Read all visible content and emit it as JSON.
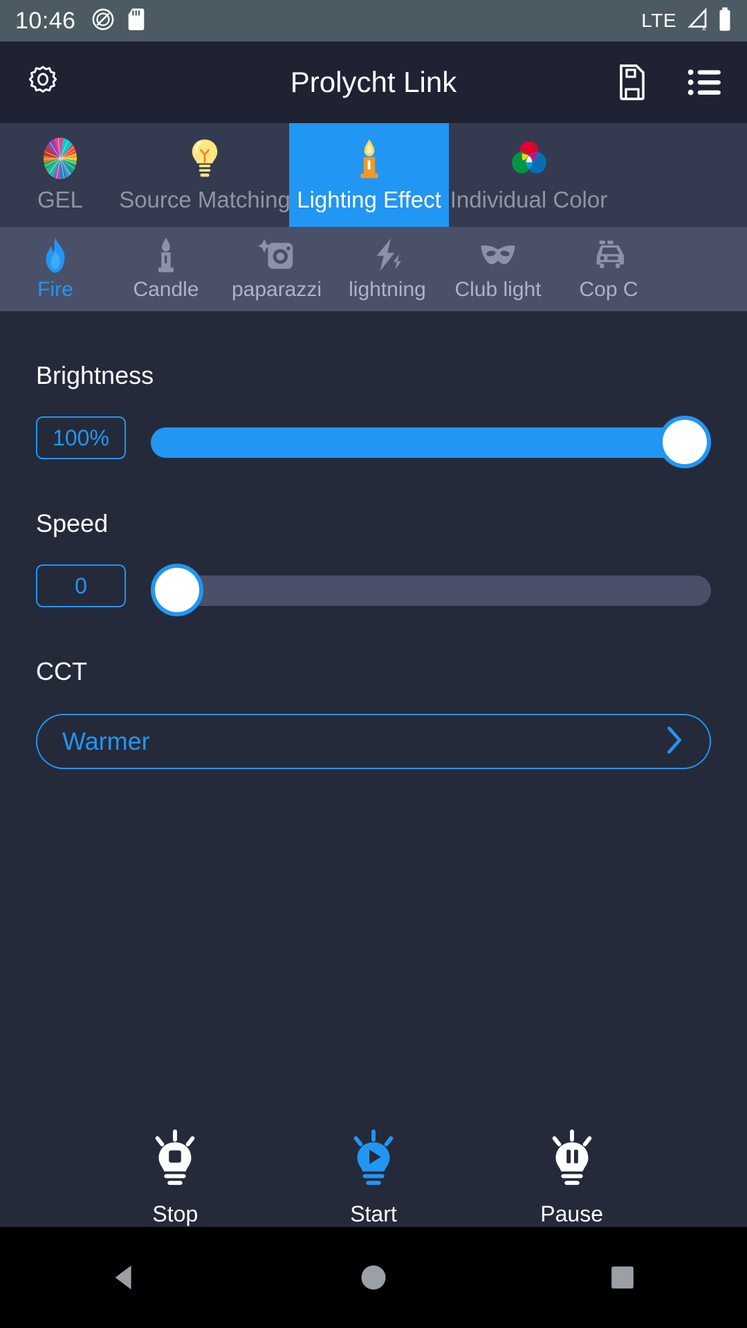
{
  "status_bar": {
    "time": "10:46",
    "icons": [
      "do-not-disturb-icon",
      "sd-card-icon"
    ],
    "network_label": "LTE",
    "right_icons": [
      "signal-no-service-icon",
      "battery-icon"
    ]
  },
  "app_bar": {
    "title": "Prolycht Link",
    "left_icon": "gear-icon",
    "right_icons": [
      "save-file-icon",
      "list-menu-icon"
    ]
  },
  "main_tabs": {
    "selected_index": 2,
    "items": [
      {
        "label": "GEL",
        "icon": "color-wheel-icon"
      },
      {
        "label": "Source Matching",
        "icon": "lightbulb-icon"
      },
      {
        "label": "Lighting Effect",
        "icon": "candle-icon"
      },
      {
        "label": "Individual Color",
        "icon": "rgb-circles-icon"
      }
    ]
  },
  "effect_tabs": {
    "selected_index": 0,
    "items": [
      {
        "label": "Fire",
        "icon": "flame-icon"
      },
      {
        "label": "Candle",
        "icon": "candle-icon"
      },
      {
        "label": "paparazzi",
        "icon": "camera-icon"
      },
      {
        "label": "lightning",
        "icon": "lightning-bolt-icon"
      },
      {
        "label": "Club light",
        "icon": "mask-icon"
      },
      {
        "label": "Cop C",
        "icon": "police-car-icon"
      }
    ]
  },
  "controls": {
    "brightness": {
      "label": "Brightness",
      "value_text": "100%",
      "percent": 100
    },
    "speed": {
      "label": "Speed",
      "value_text": "0",
      "percent": 0
    },
    "cct": {
      "label": "CCT",
      "value_text": "Warmer",
      "chevron": "chevron-right-icon"
    }
  },
  "playback": {
    "buttons": [
      {
        "label": "Stop",
        "icon": "bulb-stop-icon"
      },
      {
        "label": "Start",
        "icon": "bulb-play-icon"
      },
      {
        "label": "Pause",
        "icon": "bulb-pause-icon"
      }
    ]
  },
  "nav_bar": {
    "buttons": [
      {
        "name": "back-icon"
      },
      {
        "name": "home-icon"
      },
      {
        "name": "recents-icon"
      }
    ]
  },
  "colors": {
    "accent": "#2196f3",
    "background": "#252a3a",
    "app_bar": "#1e2233",
    "tab_bar": "#343a4f",
    "sub_tab_bar": "#4a5068",
    "status_bar": "#4c5a63",
    "muted_text": "#8f95a6"
  }
}
